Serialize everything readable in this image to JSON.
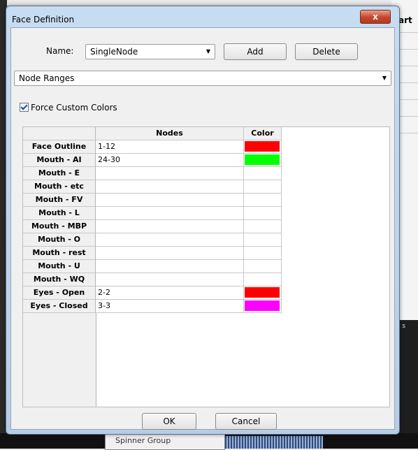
{
  "background": {
    "right_fragment_text": "art",
    "bottom_fragment_text": "Spinner Group",
    "right_small_text": "ct s"
  },
  "dialog": {
    "title": "Face Definition",
    "close_label": "x",
    "name_label": "Name:",
    "name_value": "SingleNode",
    "add_label": "Add",
    "delete_label": "Delete",
    "mode_value": "Node Ranges",
    "force_custom_colors_label": "Force Custom Colors",
    "force_custom_colors_checked": true,
    "ok_label": "OK",
    "cancel_label": "Cancel"
  },
  "grid": {
    "headers": {
      "nodes": "Nodes",
      "color": "Color"
    },
    "rows": [
      {
        "label": "Face Outline",
        "nodes": "1-12",
        "color": "#ff0000"
      },
      {
        "label": "Mouth - AI",
        "nodes": "24-30",
        "color": "#00ff00"
      },
      {
        "label": "Mouth - E",
        "nodes": "",
        "color": ""
      },
      {
        "label": "Mouth - etc",
        "nodes": "",
        "color": ""
      },
      {
        "label": "Mouth - FV",
        "nodes": "",
        "color": ""
      },
      {
        "label": "Mouth - L",
        "nodes": "",
        "color": ""
      },
      {
        "label": "Mouth - MBP",
        "nodes": "",
        "color": ""
      },
      {
        "label": "Mouth - O",
        "nodes": "",
        "color": ""
      },
      {
        "label": "Mouth - rest",
        "nodes": "",
        "color": ""
      },
      {
        "label": "Mouth - U",
        "nodes": "",
        "color": ""
      },
      {
        "label": "Mouth - WQ",
        "nodes": "",
        "color": ""
      },
      {
        "label": "Eyes - Open",
        "nodes": "2-2",
        "color": "#ff0000"
      },
      {
        "label": "Eyes - Closed",
        "nodes": "3-3",
        "color": "#ff00ff"
      }
    ]
  }
}
